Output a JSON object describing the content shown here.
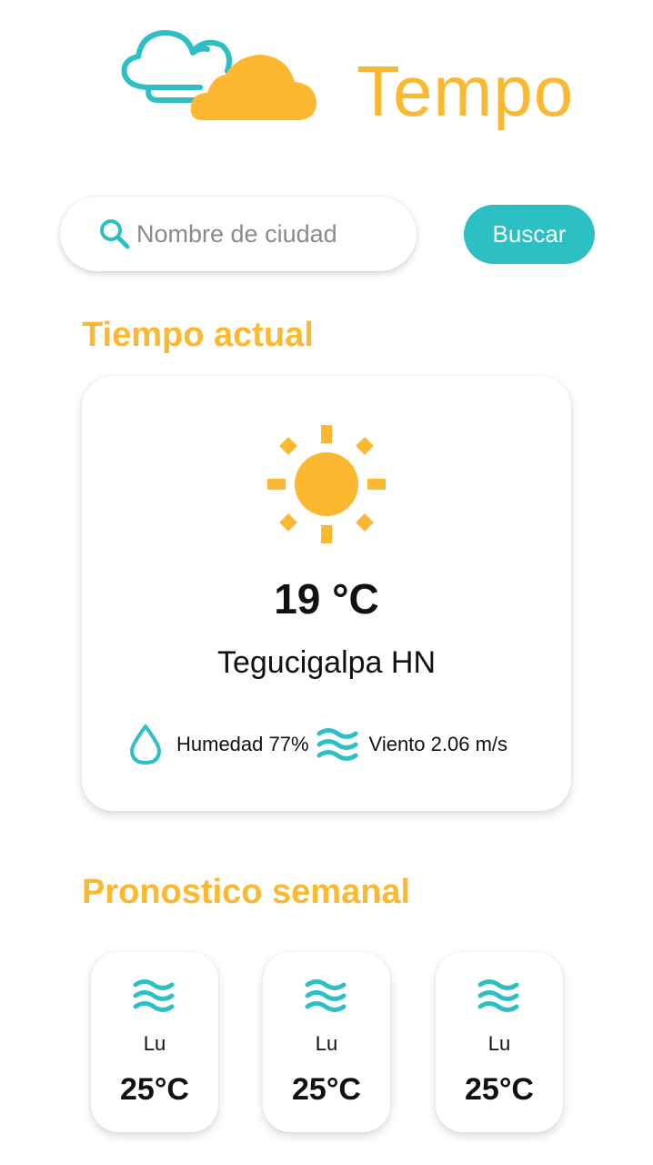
{
  "app": {
    "title": "Tempo",
    "logo_icon": "clouds-logo-icon"
  },
  "search": {
    "placeholder": "Nombre de ciudad",
    "value": "",
    "button_label": "Buscar",
    "icon": "search-icon"
  },
  "current": {
    "section_title": "Tiempo actual",
    "icon": "sun-icon",
    "temperature": "19 °C",
    "city": "Tegucigalpa HN",
    "humidity_icon": "water-drop-icon",
    "humidity_label": "Humedad 77%",
    "wind_icon": "wind-waves-icon",
    "wind_label": "Viento 2.06 m/s"
  },
  "forecast": {
    "section_title": "Pronostico semanal",
    "days": [
      {
        "day": "Lu",
        "temp": "25°C",
        "icon": "wind-waves-icon"
      },
      {
        "day": "Lu",
        "temp": "25°C",
        "icon": "wind-waves-icon"
      },
      {
        "day": "Lu",
        "temp": "25°C",
        "icon": "wind-waves-icon"
      }
    ]
  },
  "colors": {
    "accent_yellow": "#fbb830",
    "accent_teal": "#2cc0c4",
    "text": "#111111"
  }
}
